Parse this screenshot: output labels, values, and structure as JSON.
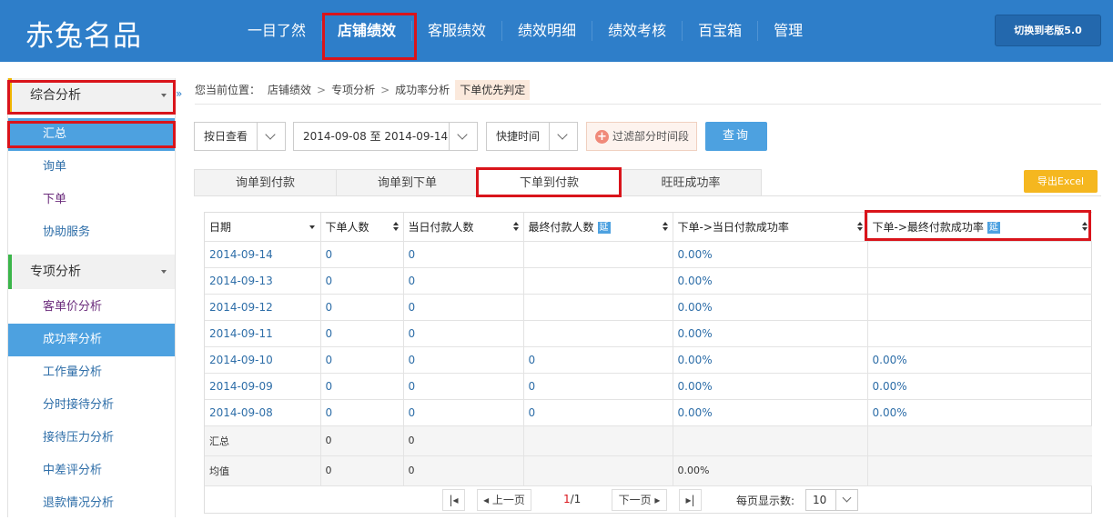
{
  "header": {
    "logo": "赤兔名品",
    "nav": [
      "一目了然",
      "店铺绩效",
      "客服绩效",
      "绩效明细",
      "绩效考核",
      "百宝箱",
      "管理"
    ],
    "active_nav": "店铺绩效",
    "old_version_button": "切换到老版5.0"
  },
  "sidebar": {
    "sections": [
      {
        "title": "综合分析",
        "items": [
          "汇总",
          "询单",
          "下单",
          "协助服务"
        ]
      },
      {
        "title": "专项分析",
        "items": [
          "客单价分析",
          "成功率分析",
          "工作量分析",
          "分时接待分析",
          "接待压力分析",
          "中差评分析",
          "退款情况分析"
        ]
      }
    ],
    "expand_glyph": "»"
  },
  "breadcrumb": {
    "prefix": "您当前位置：",
    "items": [
      "店铺绩效",
      "专项分析",
      "成功率分析"
    ],
    "current": "下单优先判定",
    "sep": ">"
  },
  "filters": {
    "view_mode": "按日查看",
    "date_range": "2014-09-08 至 2014-09-14",
    "quick_time": "快捷时间",
    "filter_period": "过滤部分时间段",
    "plus_glyph": "+",
    "query": "查询"
  },
  "tabs": [
    "询单到付款",
    "询单到下单",
    "下单到付款",
    "旺旺成功率"
  ],
  "active_tab": "下单到付款",
  "export_button": "导出Excel",
  "table": {
    "columns": [
      "日期",
      "下单人数",
      "当日付款人数",
      "最终付款人数",
      "下单->当日付款成功率",
      "下单->最终付款成功率"
    ],
    "yan_badge": "延",
    "rows": [
      [
        "2014-09-14",
        "0",
        "0",
        "",
        "0.00%",
        ""
      ],
      [
        "2014-09-13",
        "0",
        "0",
        "",
        "0.00%",
        ""
      ],
      [
        "2014-09-12",
        "0",
        "0",
        "",
        "0.00%",
        ""
      ],
      [
        "2014-09-11",
        "0",
        "0",
        "",
        "0.00%",
        ""
      ],
      [
        "2014-09-10",
        "0",
        "0",
        "0",
        "0.00%",
        "0.00%"
      ],
      [
        "2014-09-09",
        "0",
        "0",
        "0",
        "0.00%",
        "0.00%"
      ],
      [
        "2014-09-08",
        "0",
        "0",
        "0",
        "0.00%",
        "0.00%"
      ]
    ],
    "summary_rows": [
      [
        "汇总",
        "0",
        "0",
        "",
        "",
        ""
      ],
      [
        "均值",
        "0",
        "0",
        "",
        "0.00%",
        ""
      ]
    ]
  },
  "pager": {
    "first": "|◂",
    "prev": "◂ 上一页",
    "current_page": "1",
    "total_pages": "/1",
    "next": "下一页 ▸",
    "last": "▸|",
    "per_page_label": "每页显示数:",
    "per_page_value": "10"
  }
}
